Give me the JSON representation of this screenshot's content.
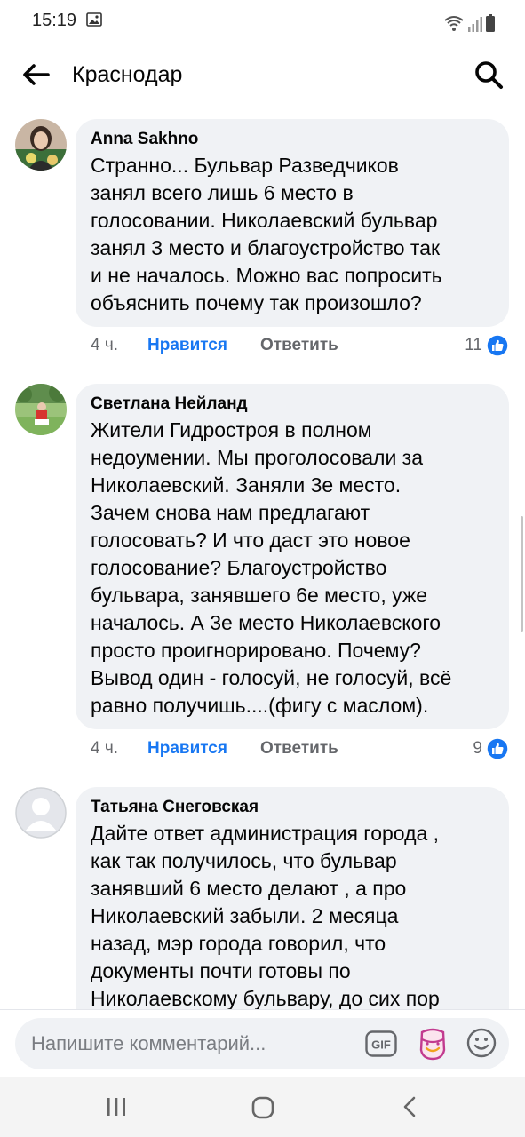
{
  "status_bar": {
    "time": "15:19"
  },
  "header": {
    "title": "Краснодар"
  },
  "comments": [
    {
      "author": "Anna Sakhno",
      "text": "Странно... Бульвар Разведчиков\nзанял всего лишь 6 место в\nголосовании. Николаевский бульвар\nзанял 3 место и благоустройство так\nи не началось. Можно вас попросить\nобъяснить почему так произошло?",
      "time": "4 ч.",
      "like_label": "Нравится",
      "reply_label": "Ответить",
      "likes": "11"
    },
    {
      "author": "Светлана Нейланд",
      "text": "Жители Гидростроя в полном\nнедоумении. Мы проголосовали за\nНиколаевский. Заняли 3е место.\nЗачем снова нам предлагают\nголосовать? И что даст это новое\nголосование? Благоустройство\nбульвара, занявшего 6е место, уже\nначалось. А 3е место Николаевского\nпросто проигнорировано. Почему?\nВывод один - голосуй, не голосуй, всё\nравно получишь....(фигу с маслом).",
      "time": "4 ч.",
      "like_label": "Нравится",
      "reply_label": "Ответить",
      "likes": "9"
    },
    {
      "author": "Татьяна Снеговская",
      "text": "Дайте ответ администрация города ,\nкак так получилось, что бульвар\nзанявший 6 место делают , а про\nНиколаевский забыли.  2 месяца\nназад, мэр города говорил, что\nдокументы почти готовы по\nНиколаевскому бульвару, до сих пор"
    }
  ],
  "composer": {
    "placeholder": "Напишите комментарий...",
    "gif_label": "GIF"
  },
  "colors": {
    "accent": "#1877f2",
    "bubble": "#f0f2f5",
    "secondary_text": "#65676b"
  },
  "icons": [
    "back-arrow-icon",
    "search-icon",
    "like-thumb-icon",
    "gif-icon",
    "sticker-icon",
    "emoji-icon",
    "recents-icon",
    "home-icon",
    "nav-back-icon"
  ]
}
